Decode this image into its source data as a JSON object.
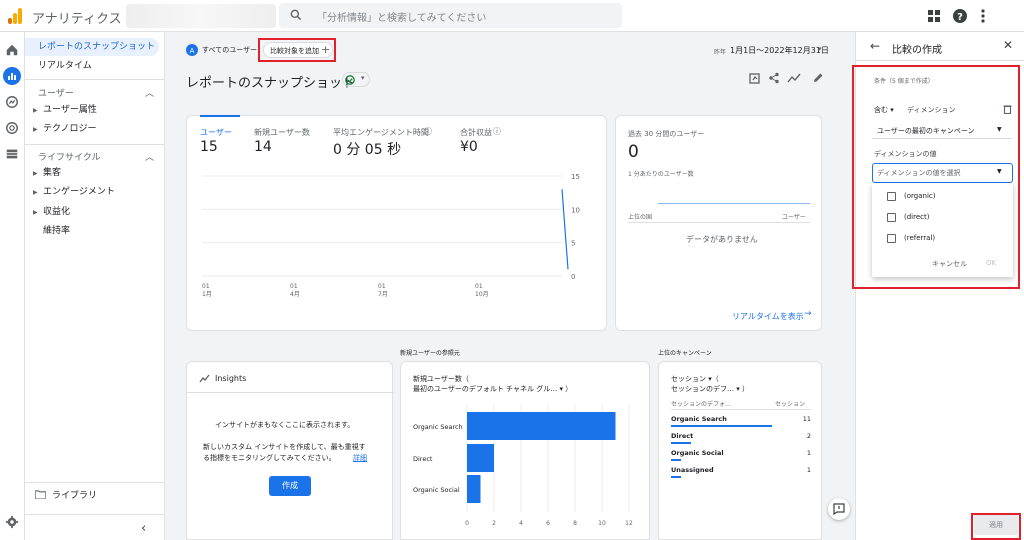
{
  "header": {
    "app_title": "アナリティクス",
    "search_placeholder": "「分析情報」と検索してみてください"
  },
  "sidebar": {
    "items": [
      {
        "label": "レポートのスナップショット"
      },
      {
        "label": "リアルタイム"
      }
    ],
    "user_section": {
      "title": "ユーザー",
      "items": [
        "ユーザー属性",
        "テクノロジー"
      ]
    },
    "lifecycle_section": {
      "title": "ライフサイクル",
      "items": [
        "集客",
        "エンゲージメント",
        "収益化",
        "維持率"
      ]
    },
    "library_label": "ライブラリ"
  },
  "main": {
    "all_users_chip": "すべてのユーザー",
    "add_comparison_chip": "比較対象を追加",
    "date_prefix": "昨年",
    "date_range": "1月1日～2022年12月31日",
    "page_title": "レポートのスナップショット",
    "metrics": [
      {
        "label": "ユーザー",
        "value": "15"
      },
      {
        "label": "新規ユーザー数",
        "value": "14"
      },
      {
        "label": "平均エンゲージメント時間",
        "value": "0 分 05 秒"
      },
      {
        "label": "合計収益",
        "value": "¥0"
      }
    ],
    "realtime": {
      "title": "過去 30 分間のユーザー",
      "value": "0",
      "per_minute": "1 分あたりのユーザー数",
      "top_country": "上位の国",
      "users_col": "ユーザー",
      "no_data": "データがありません",
      "link": "リアルタイムを表示"
    },
    "insights": {
      "title": "Insights",
      "line1": "インサイトがまもなくここに表示されます。",
      "line2": "新しいカスタム インサイトを作成して、最も重視す",
      "line3": "る指標をモニタリングしてみてください。",
      "detail_link": "詳細",
      "create_button": "作成"
    },
    "new_users_section": "新規ユーザーの参照元",
    "new_users_card": {
      "title_line1": "新規ユーザー数（",
      "title_line2": "最初のユーザーのデフォルト チャネル グル… ▾ ）"
    },
    "campaign_section": "上位のキャンペーン",
    "campaign_card": {
      "title_line1": "セッション ▾（",
      "title_line2": "セッションのデフ… ▾ ）",
      "col1": "セッションのデフォ…",
      "col2": "セッション",
      "rows": [
        {
          "name": "Organic Search",
          "value": "11",
          "bar": 0.9
        },
        {
          "name": "Direct",
          "value": "2",
          "bar": 0.18
        },
        {
          "name": "Organic Social",
          "value": "1",
          "bar": 0.09
        },
        {
          "name": "Unassigned",
          "value": "1",
          "bar": 0.09
        }
      ]
    }
  },
  "panel": {
    "title": "比較の作成",
    "conditions_hint": "条件（5 個まで作成）",
    "include_label": "含む ▾",
    "dimension_label": "ディメンション",
    "dimension_select": "ユーザーの最初のキャンペーン",
    "dimension_value_label": "ディメンションの値",
    "dimension_value_placeholder": "ディメンションの値を選択",
    "options": [
      "(organic)",
      "(direct)",
      "(referral)"
    ],
    "cancel": "キャンセル",
    "ok": "OK",
    "apply": "適用"
  },
  "chart_data": [
    {
      "type": "line",
      "x": [
        "01 1月",
        "01 4月",
        "01 7月",
        "01 10月"
      ],
      "y_ticks": [
        0,
        5,
        10,
        15
      ],
      "ylim": [
        0,
        15
      ],
      "series": [
        {
          "points": [
            {
              "x": "12月末",
              "y": 13
            },
            {
              "x": "12月31日",
              "y": 1
            }
          ]
        }
      ]
    },
    {
      "type": "bar",
      "orientation": "horizontal",
      "categories": [
        "Organic Search",
        "Direct",
        "Organic Social"
      ],
      "values": [
        11,
        2,
        1
      ],
      "x_ticks": [
        0,
        2,
        4,
        6,
        8,
        10,
        12
      ],
      "xlim": [
        0,
        12
      ]
    }
  ],
  "colors": {
    "accent": "#1a73e8",
    "highlight": "#e0202c"
  }
}
